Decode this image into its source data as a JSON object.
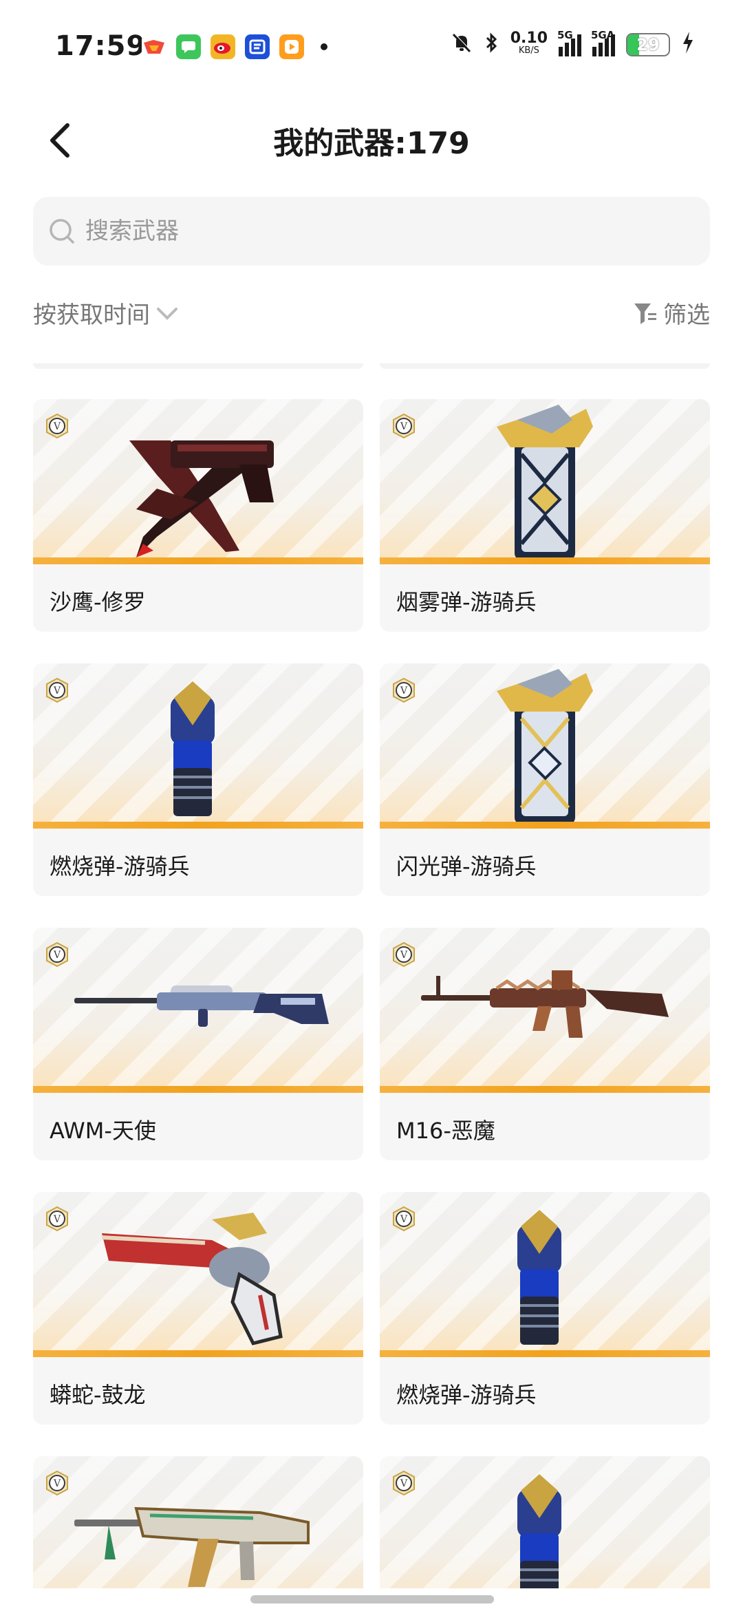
{
  "status_bar": {
    "time": "17:59",
    "net_speed": "0.10",
    "net_speed_unit": "KB/S",
    "sim1_label": "5G",
    "sim2_label": "5GA",
    "battery_level": "29",
    "notification_apps": [
      "game-app-icon",
      "messages-icon",
      "weibo-icon",
      "recruit-icon",
      "video-app-icon"
    ]
  },
  "header": {
    "title": "我的武器:179"
  },
  "search": {
    "placeholder": "搜索武器"
  },
  "toolbar": {
    "sort_label": "按获取时间",
    "filter_label": "筛选"
  },
  "weapons": [
    {
      "name": "沙鹰-修罗",
      "art": "desert-eagle-pistol"
    },
    {
      "name": "烟雾弹-游骑兵",
      "art": "smoke-grenade-winged"
    },
    {
      "name": "燃烧弹-游骑兵",
      "art": "molotov-blue"
    },
    {
      "name": "闪光弹-游骑兵",
      "art": "flash-grenade-winged"
    },
    {
      "name": "AWM-天使",
      "art": "sniper-rifle"
    },
    {
      "name": "M16-恶魔",
      "art": "assault-rifle"
    },
    {
      "name": "蟒蛇-鼓龙",
      "art": "revolver-dragon"
    },
    {
      "name": "燃烧弹-游骑兵",
      "art": "molotov-blue"
    },
    {
      "art": "rifle-ornate"
    },
    {
      "art": "molotov-blue"
    }
  ],
  "colors": {
    "accent_bar": "#f1a21e",
    "battery_fill": "#35c759",
    "badge_gold": "#c9a441"
  }
}
